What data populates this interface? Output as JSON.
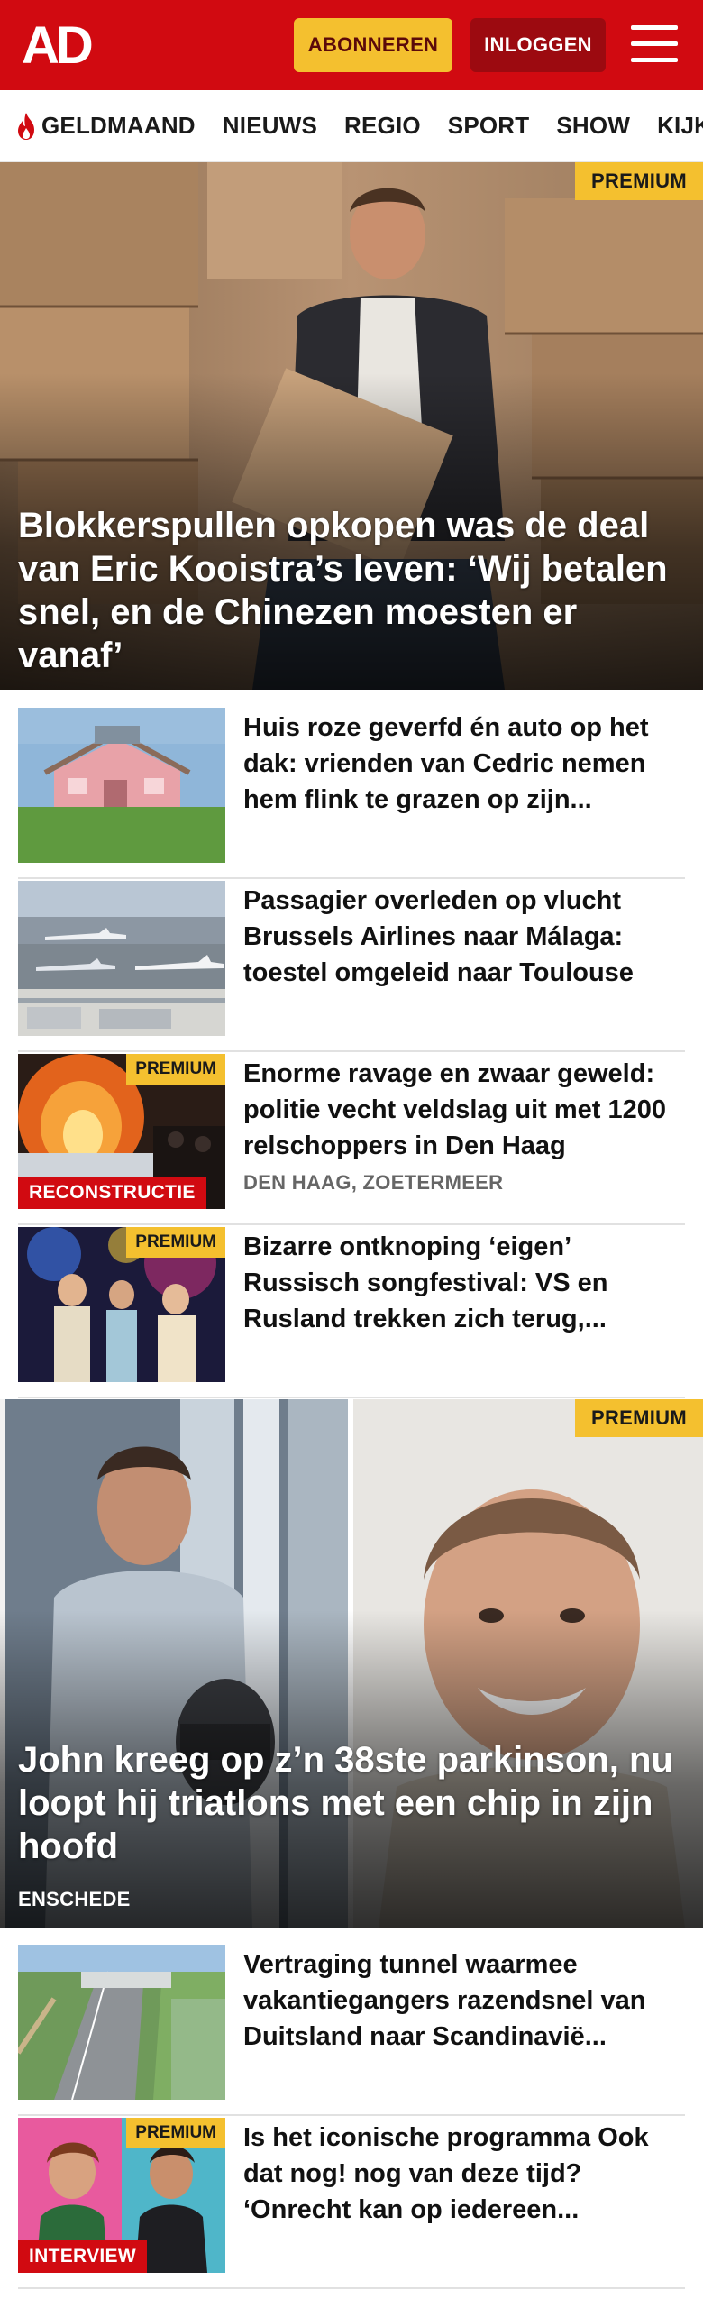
{
  "header": {
    "logo_text": "AD",
    "subscribe_label": "ABONNEREN",
    "login_label": "INLOGGEN",
    "menu_icon": "hamburger-menu-icon",
    "colors": {
      "brand_red": "#d10a11",
      "accent_yellow": "#f4c02f",
      "login_dark_red": "#9c0a10"
    }
  },
  "nav": {
    "items": [
      {
        "label": "GELDMAAND",
        "icon": "flame-icon"
      },
      {
        "label": "NIEUWS"
      },
      {
        "label": "REGIO"
      },
      {
        "label": "SPORT"
      },
      {
        "label": "SHOW"
      },
      {
        "label": "KIJK"
      }
    ]
  },
  "hero1": {
    "badge": "PREMIUM",
    "title": "Blokkerspullen opkopen was de deal van Eric Kooistra’s leven: ‘Wij betalen snel, en de Chinezen moesten er vanaf’"
  },
  "articles": [
    {
      "title": "Huis roze geverfd én auto op het dak: vrienden van Cedric nemen hem flink te grazen op zijn..."
    },
    {
      "title": "Passagier overleden op vlucht Brussels Airlines naar Málaga: toestel omgeleid naar Toulouse"
    },
    {
      "title": "Enorme ravage en zwaar geweld: politie vecht veldslag uit met 1200 relschoppers in Den Haag",
      "badge": "PREMIUM",
      "label": "RECONSTRUCTIE",
      "location": "DEN HAAG, ZOETERMEER"
    },
    {
      "title": "Bizarre ontknoping ‘eigen’ Russisch songfestival: VS en Rusland trekken zich terug,...",
      "badge": "PREMIUM"
    }
  ],
  "hero2": {
    "badge": "PREMIUM",
    "title": "John kreeg op z’n 38ste parkinson, nu loopt hij triatlons met een chip in zijn hoofd",
    "location": "ENSCHEDE"
  },
  "articles2": [
    {
      "title": "Vertraging tunnel waarmee vakantiegangers razendsnel van Duitsland naar Scandinavië..."
    },
    {
      "title": "Is het iconische programma Ook dat nog! nog van deze tijd? ‘Onrecht kan op iedereen...",
      "badge": "PREMIUM",
      "label": "INTERVIEW"
    }
  ]
}
